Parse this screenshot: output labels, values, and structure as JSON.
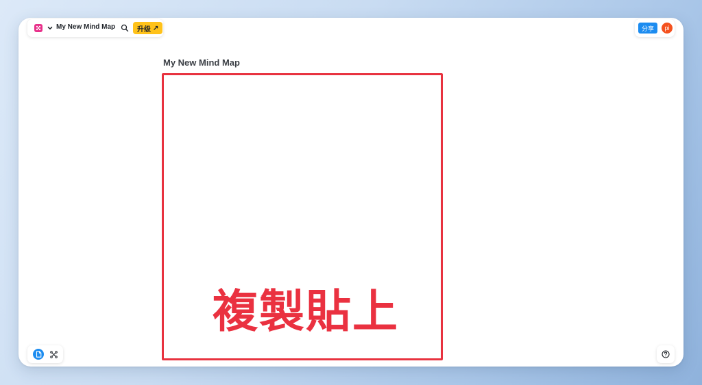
{
  "header": {
    "doc_title": "My New Mind Map",
    "upgrade_label": "升级",
    "upgrade_arrow": "↗",
    "share_label": "分享",
    "avatar_initials": "pi"
  },
  "canvas": {
    "map_title": "My New Mind Map",
    "overlay_caption": "複製貼上"
  },
  "colors": {
    "brand": "#e8308a",
    "accent": "#1c8cf0",
    "upgrade": "#ffc21a",
    "highlight": "#e8323f",
    "avatar": "#f4511e"
  },
  "icons": {
    "logo": "app-logo-icon",
    "dropdown": "chevron-down-icon",
    "search": "search-icon",
    "doc_view": "document-icon",
    "mindmap_view": "mindmap-icon",
    "help": "help-icon"
  }
}
